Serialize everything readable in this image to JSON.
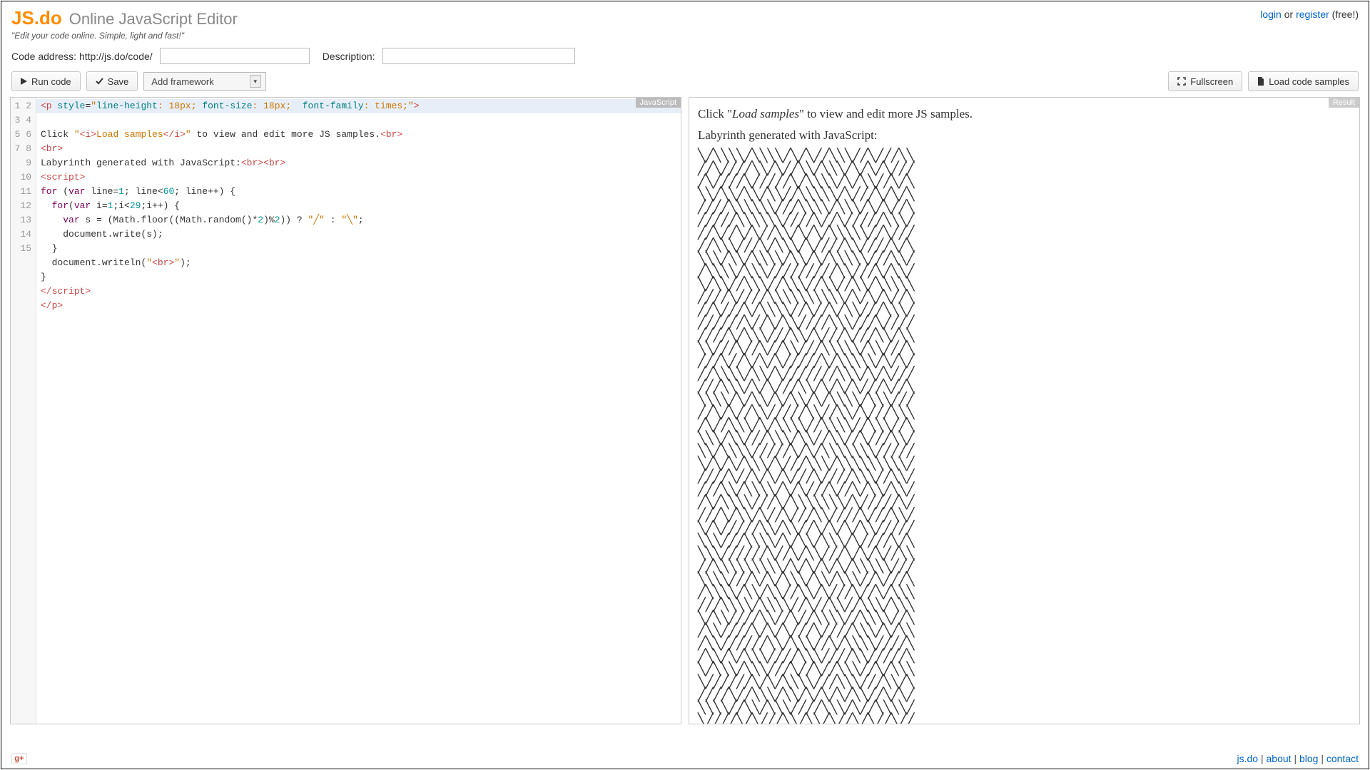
{
  "header": {
    "logo": "JS.do",
    "subtitle": "Online JavaScript Editor",
    "tagline": "\"Edit your code online. Simple, light and fast!\"",
    "auth": {
      "login": "login",
      "or": " or ",
      "register": "register",
      "free": " (free!)"
    }
  },
  "meta": {
    "code_address_label": "Code address: http://js.do/code/",
    "code_address_value": "",
    "description_label": "Description:",
    "description_value": ""
  },
  "toolbar": {
    "run_label": "Run code",
    "save_label": "Save",
    "add_framework_label": "Add framework",
    "fullscreen_label": "Fullscreen",
    "load_samples_label": "Load code samples"
  },
  "editor": {
    "language_badge": "JavaScript",
    "line_count": 15,
    "code_lines": [
      {
        "raw": "<p style=\"line-height: 18px; font-size: 18px;  font-family: times;\">"
      },
      {
        "raw": "Click \"<i>Load samples</i>\" to view and edit more JS samples.<br>"
      },
      {
        "raw": "<br>"
      },
      {
        "raw": "Labyrinth generated with JavaScript:<br><br>"
      },
      {
        "raw": "<script>"
      },
      {
        "raw": "for (var line=1; line<60; line++) {"
      },
      {
        "raw": "  for(var i=1;i<29;i++) {"
      },
      {
        "raw": "    var s = (Math.floor((Math.random()*2)%2)) ? \"╱\" : \"╲\";"
      },
      {
        "raw": "    document.write(s);"
      },
      {
        "raw": "  }"
      },
      {
        "raw": "  document.writeln(\"<br>\");"
      },
      {
        "raw": "}"
      },
      {
        "raw": "</script>"
      },
      {
        "raw": "</p>"
      },
      {
        "raw": ""
      }
    ]
  },
  "result": {
    "badge": "Result",
    "intro_prefix": "Click \"",
    "intro_em": "Load samples",
    "intro_suffix": "\" to view and edit more JS samples.",
    "heading": "Labyrinth generated with JavaScript:",
    "maze": {
      "cols": 28,
      "rows": 45,
      "chars": [
        "╱",
        "╲"
      ]
    }
  },
  "footer": {
    "links": [
      "js.do",
      "about",
      "blog",
      "contact"
    ],
    "gplus": "g+"
  }
}
